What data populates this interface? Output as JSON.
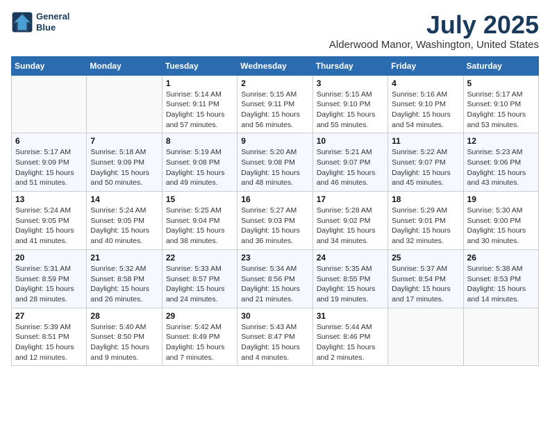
{
  "header": {
    "logo_line1": "General",
    "logo_line2": "Blue",
    "title": "July 2025",
    "subtitle": "Alderwood Manor, Washington, United States"
  },
  "weekdays": [
    "Sunday",
    "Monday",
    "Tuesday",
    "Wednesday",
    "Thursday",
    "Friday",
    "Saturday"
  ],
  "weeks": [
    [
      {
        "day": "",
        "sunrise": "",
        "sunset": "",
        "daylight": ""
      },
      {
        "day": "",
        "sunrise": "",
        "sunset": "",
        "daylight": ""
      },
      {
        "day": "1",
        "sunrise": "Sunrise: 5:14 AM",
        "sunset": "Sunset: 9:11 PM",
        "daylight": "Daylight: 15 hours and 57 minutes."
      },
      {
        "day": "2",
        "sunrise": "Sunrise: 5:15 AM",
        "sunset": "Sunset: 9:11 PM",
        "daylight": "Daylight: 15 hours and 56 minutes."
      },
      {
        "day": "3",
        "sunrise": "Sunrise: 5:15 AM",
        "sunset": "Sunset: 9:10 PM",
        "daylight": "Daylight: 15 hours and 55 minutes."
      },
      {
        "day": "4",
        "sunrise": "Sunrise: 5:16 AM",
        "sunset": "Sunset: 9:10 PM",
        "daylight": "Daylight: 15 hours and 54 minutes."
      },
      {
        "day": "5",
        "sunrise": "Sunrise: 5:17 AM",
        "sunset": "Sunset: 9:10 PM",
        "daylight": "Daylight: 15 hours and 53 minutes."
      }
    ],
    [
      {
        "day": "6",
        "sunrise": "Sunrise: 5:17 AM",
        "sunset": "Sunset: 9:09 PM",
        "daylight": "Daylight: 15 hours and 51 minutes."
      },
      {
        "day": "7",
        "sunrise": "Sunrise: 5:18 AM",
        "sunset": "Sunset: 9:09 PM",
        "daylight": "Daylight: 15 hours and 50 minutes."
      },
      {
        "day": "8",
        "sunrise": "Sunrise: 5:19 AM",
        "sunset": "Sunset: 9:08 PM",
        "daylight": "Daylight: 15 hours and 49 minutes."
      },
      {
        "day": "9",
        "sunrise": "Sunrise: 5:20 AM",
        "sunset": "Sunset: 9:08 PM",
        "daylight": "Daylight: 15 hours and 48 minutes."
      },
      {
        "day": "10",
        "sunrise": "Sunrise: 5:21 AM",
        "sunset": "Sunset: 9:07 PM",
        "daylight": "Daylight: 15 hours and 46 minutes."
      },
      {
        "day": "11",
        "sunrise": "Sunrise: 5:22 AM",
        "sunset": "Sunset: 9:07 PM",
        "daylight": "Daylight: 15 hours and 45 minutes."
      },
      {
        "day": "12",
        "sunrise": "Sunrise: 5:23 AM",
        "sunset": "Sunset: 9:06 PM",
        "daylight": "Daylight: 15 hours and 43 minutes."
      }
    ],
    [
      {
        "day": "13",
        "sunrise": "Sunrise: 5:24 AM",
        "sunset": "Sunset: 9:05 PM",
        "daylight": "Daylight: 15 hours and 41 minutes."
      },
      {
        "day": "14",
        "sunrise": "Sunrise: 5:24 AM",
        "sunset": "Sunset: 9:05 PM",
        "daylight": "Daylight: 15 hours and 40 minutes."
      },
      {
        "day": "15",
        "sunrise": "Sunrise: 5:25 AM",
        "sunset": "Sunset: 9:04 PM",
        "daylight": "Daylight: 15 hours and 38 minutes."
      },
      {
        "day": "16",
        "sunrise": "Sunrise: 5:27 AM",
        "sunset": "Sunset: 9:03 PM",
        "daylight": "Daylight: 15 hours and 36 minutes."
      },
      {
        "day": "17",
        "sunrise": "Sunrise: 5:28 AM",
        "sunset": "Sunset: 9:02 PM",
        "daylight": "Daylight: 15 hours and 34 minutes."
      },
      {
        "day": "18",
        "sunrise": "Sunrise: 5:29 AM",
        "sunset": "Sunset: 9:01 PM",
        "daylight": "Daylight: 15 hours and 32 minutes."
      },
      {
        "day": "19",
        "sunrise": "Sunrise: 5:30 AM",
        "sunset": "Sunset: 9:00 PM",
        "daylight": "Daylight: 15 hours and 30 minutes."
      }
    ],
    [
      {
        "day": "20",
        "sunrise": "Sunrise: 5:31 AM",
        "sunset": "Sunset: 8:59 PM",
        "daylight": "Daylight: 15 hours and 28 minutes."
      },
      {
        "day": "21",
        "sunrise": "Sunrise: 5:32 AM",
        "sunset": "Sunset: 8:58 PM",
        "daylight": "Daylight: 15 hours and 26 minutes."
      },
      {
        "day": "22",
        "sunrise": "Sunrise: 5:33 AM",
        "sunset": "Sunset: 8:57 PM",
        "daylight": "Daylight: 15 hours and 24 minutes."
      },
      {
        "day": "23",
        "sunrise": "Sunrise: 5:34 AM",
        "sunset": "Sunset: 8:56 PM",
        "daylight": "Daylight: 15 hours and 21 minutes."
      },
      {
        "day": "24",
        "sunrise": "Sunrise: 5:35 AM",
        "sunset": "Sunset: 8:55 PM",
        "daylight": "Daylight: 15 hours and 19 minutes."
      },
      {
        "day": "25",
        "sunrise": "Sunrise: 5:37 AM",
        "sunset": "Sunset: 8:54 PM",
        "daylight": "Daylight: 15 hours and 17 minutes."
      },
      {
        "day": "26",
        "sunrise": "Sunrise: 5:38 AM",
        "sunset": "Sunset: 8:53 PM",
        "daylight": "Daylight: 15 hours and 14 minutes."
      }
    ],
    [
      {
        "day": "27",
        "sunrise": "Sunrise: 5:39 AM",
        "sunset": "Sunset: 8:51 PM",
        "daylight": "Daylight: 15 hours and 12 minutes."
      },
      {
        "day": "28",
        "sunrise": "Sunrise: 5:40 AM",
        "sunset": "Sunset: 8:50 PM",
        "daylight": "Daylight: 15 hours and 9 minutes."
      },
      {
        "day": "29",
        "sunrise": "Sunrise: 5:42 AM",
        "sunset": "Sunset: 8:49 PM",
        "daylight": "Daylight: 15 hours and 7 minutes."
      },
      {
        "day": "30",
        "sunrise": "Sunrise: 5:43 AM",
        "sunset": "Sunset: 8:47 PM",
        "daylight": "Daylight: 15 hours and 4 minutes."
      },
      {
        "day": "31",
        "sunrise": "Sunrise: 5:44 AM",
        "sunset": "Sunset: 8:46 PM",
        "daylight": "Daylight: 15 hours and 2 minutes."
      },
      {
        "day": "",
        "sunrise": "",
        "sunset": "",
        "daylight": ""
      },
      {
        "day": "",
        "sunrise": "",
        "sunset": "",
        "daylight": ""
      }
    ]
  ]
}
